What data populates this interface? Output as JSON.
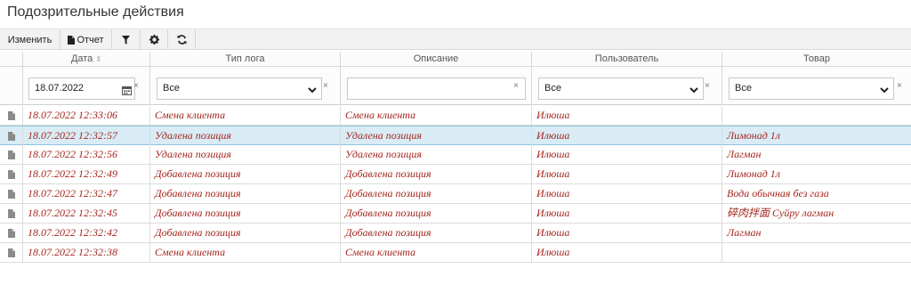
{
  "page": {
    "title": "Подозрительные действия"
  },
  "toolbar": {
    "edit_label": "Изменить",
    "report_label": "Отчет",
    "icons": [
      "file-icon",
      "filter-icon",
      "gear-icon",
      "refresh-icon"
    ]
  },
  "columns": {
    "date": "Дата",
    "log_type": "Тип лога",
    "description": "Описание",
    "user": "Пользователь",
    "product": "Товар"
  },
  "filters": {
    "date_value": "18.07.2022",
    "log_type_value": "Все",
    "description_value": "",
    "user_value": "Все",
    "product_value": "Все",
    "clear_symbol": "×"
  },
  "rows": [
    {
      "date": "18.07.2022 12:33:06",
      "log_type": "Смена клиента",
      "description": "Смена клиента",
      "user": "Илюша",
      "product": "",
      "selected": false
    },
    {
      "date": "18.07.2022 12:32:57",
      "log_type": "Удалена позиция",
      "description": "Удалена позиция",
      "user": "Илюша",
      "product": "Лимонад 1л",
      "selected": true
    },
    {
      "date": "18.07.2022 12:32:56",
      "log_type": "Удалена позиция",
      "description": "Удалена позиция",
      "user": "Илюша",
      "product": "Лагман",
      "selected": false
    },
    {
      "date": "18.07.2022 12:32:49",
      "log_type": "Добавлена позиция",
      "description": "Добавлена позиция",
      "user": "Илюша",
      "product": "Лимонад 1л",
      "selected": false
    },
    {
      "date": "18.07.2022 12:32:47",
      "log_type": "Добавлена позиция",
      "description": "Добавлена позиция",
      "user": "Илюша",
      "product": "Вода обычная без газа",
      "selected": false
    },
    {
      "date": "18.07.2022 12:32:45",
      "log_type": "Добавлена позиция",
      "description": "Добавлена позиция",
      "user": "Илюша",
      "product": "碎肉拌面 Суйру лагман",
      "selected": false
    },
    {
      "date": "18.07.2022 12:32:42",
      "log_type": "Добавлена позиция",
      "description": "Добавлена позиция",
      "user": "Илюша",
      "product": "Лагман",
      "selected": false
    },
    {
      "date": "18.07.2022 12:32:38",
      "log_type": "Смена клиента",
      "description": "Смена клиента",
      "user": "Илюша",
      "product": "",
      "selected": false
    }
  ],
  "colors": {
    "row_text": "#a4261d",
    "selected_row": "#d9ecf6"
  }
}
